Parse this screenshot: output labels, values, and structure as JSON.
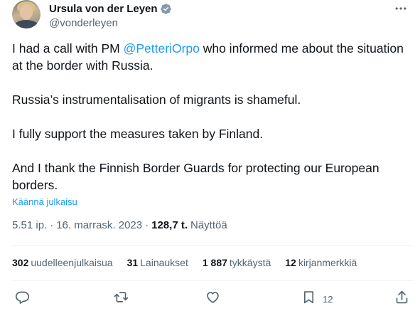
{
  "author": {
    "display_name": "Ursula von der Leyen",
    "handle": "@vonderleyen",
    "verified_icon": "verified-badge-icon",
    "more_icon": "more-options-icon"
  },
  "tweet": {
    "line1_prefix": "I had a call with PM ",
    "line1_mention": "@PetteriOrpo",
    "line1_suffix": " who informed me about the situation at the border with Russia.",
    "paragraph2": "Russia’s instrumentalisation of migrants is shameful.",
    "paragraph3": "I fully support the measures taken by Finland.",
    "paragraph4": "And I thank the Finnish Border Guards for protecting our European borders.",
    "translate_label": "Käännä julkaisu"
  },
  "meta": {
    "time": "5.51 ip.",
    "separator": "·",
    "date": "16. marrask. 2023",
    "views_count": "128,7 t.",
    "views_label": "Näyttöä"
  },
  "stats": {
    "reposts_count": "302",
    "reposts_label": "uudelleenjulkaisua",
    "quotes_count": "31",
    "quotes_label": "Lainaukset",
    "likes_count": "1 887",
    "likes_label": "tykkäystä",
    "bookmarks_count": "12",
    "bookmarks_label": "kirjanmerkkiä"
  },
  "actions": {
    "reply_icon": "reply-icon",
    "repost_icon": "repost-icon",
    "like_icon": "like-icon",
    "bookmark_icon": "bookmark-icon",
    "bookmark_count": "12",
    "share_icon": "share-icon"
  },
  "colors": {
    "link": "#1d9bf0",
    "text": "#0f1419",
    "secondary": "#536471",
    "divider": "#eff3f4"
  }
}
